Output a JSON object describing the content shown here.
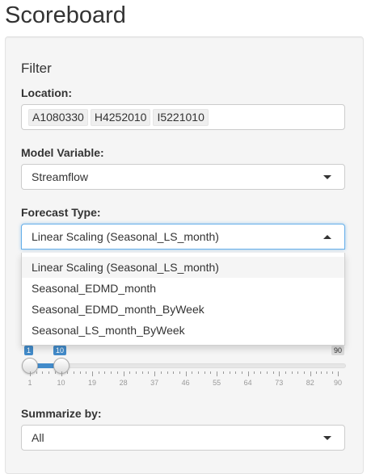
{
  "page_title": "Scoreboard",
  "filter": {
    "heading": "Filter",
    "location": {
      "label": "Location:",
      "chips": [
        "A1080330",
        "H4252010",
        "I5221010"
      ]
    },
    "model_variable": {
      "label": "Model Variable:",
      "value": "Streamflow"
    },
    "forecast_type": {
      "label": "Forecast Type:",
      "value": "Linear Scaling (Seasonal_LS_month)",
      "options": [
        "Linear Scaling (Seasonal_LS_month)",
        "Seasonal_EDMD_month",
        "Seasonal_EDMD_month_ByWeek",
        "Seasonal_LS_month_ByWeek"
      ]
    },
    "slider": {
      "min": 1,
      "max": 90,
      "from": 1,
      "to": 10,
      "min_label": "1",
      "max_label": "90",
      "from_label": "1",
      "to_label": "10",
      "ticks": [
        "1",
        "10",
        "19",
        "28",
        "37",
        "46",
        "55",
        "64",
        "73",
        "82",
        "90"
      ]
    },
    "summarize_by": {
      "label": "Summarize by:",
      "value": "All"
    }
  },
  "colors": {
    "accent": "#428bca",
    "focus_border": "#66afe9"
  }
}
